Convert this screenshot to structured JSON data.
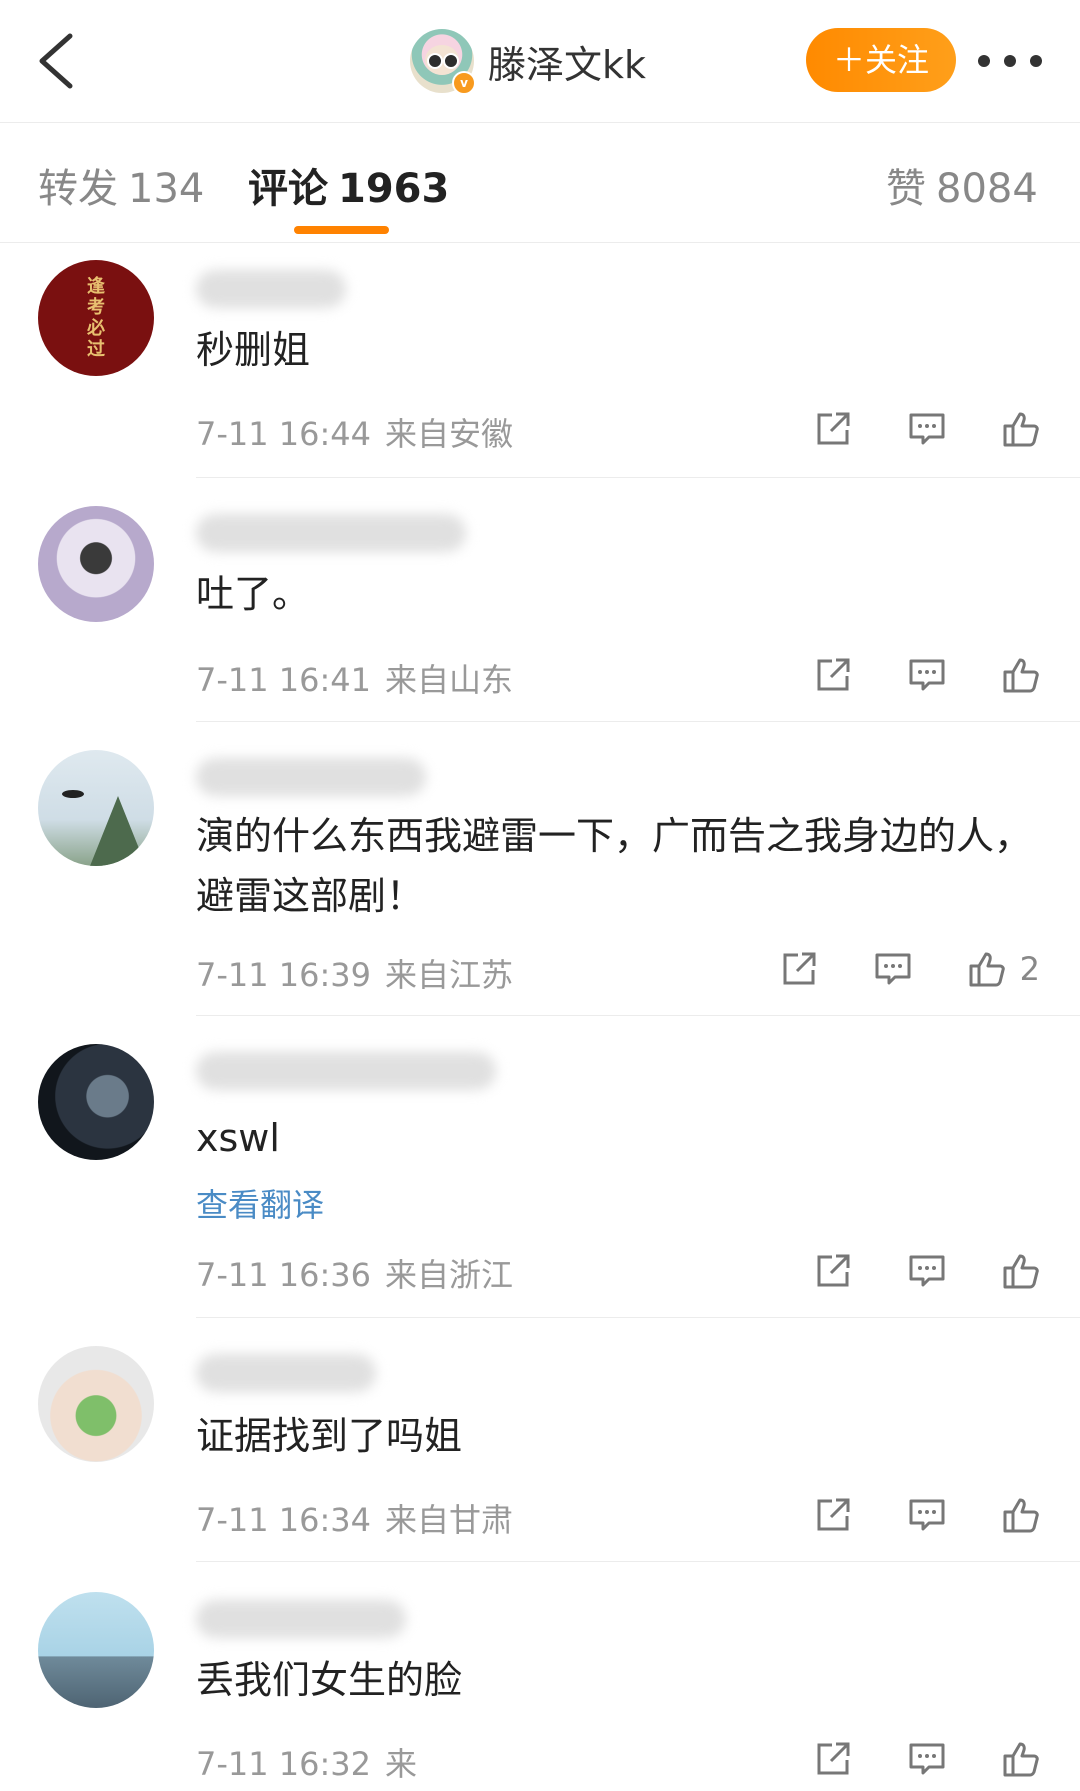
{
  "header": {
    "author_name": "滕泽文kk",
    "follow_label": "＋关注"
  },
  "tabs": [
    {
      "label": "转发",
      "count": "134"
    },
    {
      "label": "评论",
      "count": "1963"
    },
    {
      "label": "赞",
      "count": "8084"
    }
  ],
  "comments": [
    {
      "text": "秒删姐",
      "date": "7-11 16:44",
      "source": "来自安徽",
      "avatar_text": "逢考必过",
      "likes": ""
    },
    {
      "text": "吐了。",
      "date": "7-11 16:41",
      "source": "来自山东",
      "likes": ""
    },
    {
      "text": "演的什么东西我避雷一下，广而告之我身边的人，避雷这部剧！",
      "date": "7-11 16:39",
      "source": "来自江苏",
      "likes": "2"
    },
    {
      "text": "xswl",
      "translate": "查看翻译",
      "date": "7-11 16:36",
      "source": "来自浙江",
      "likes": ""
    },
    {
      "text": "证据找到了吗姐",
      "date": "7-11 16:34",
      "source": "来自甘肃",
      "likes": ""
    },
    {
      "text": "丢我们女生的脸",
      "date": "7-11 16:32",
      "source": "来",
      "likes": ""
    }
  ],
  "colors": {
    "accent": "#ff8200",
    "link": "#4a8bc5"
  }
}
